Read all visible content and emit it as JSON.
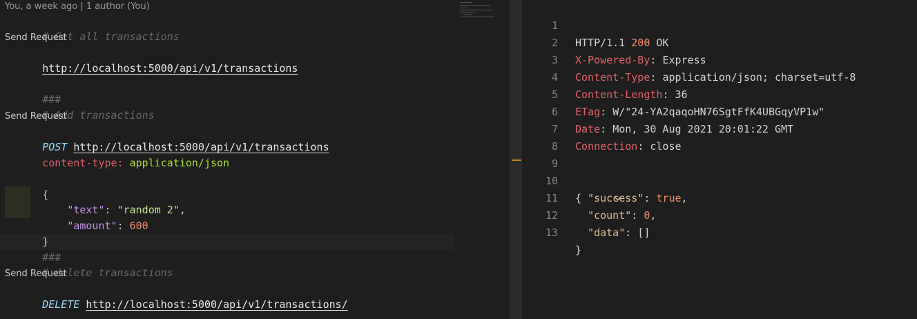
{
  "editor": {
    "blame": "You, a week ago | 1 author (You)",
    "send_request": "Send Request",
    "blocks": {
      "get": {
        "comment": "# Get all transactions",
        "url": "http://localhost:5000/api/v1/transactions"
      },
      "sep1": "###",
      "add": {
        "comment": "# Add transactions",
        "method": "POST",
        "url": "http://localhost:5000/api/v1/transactions",
        "header_key": "content-type:",
        "header_value": "application/json",
        "open_brace": "{",
        "text_key": "\"text\"",
        "text_value": "\"random 2\"",
        "amount_key": "\"amount\"",
        "amount_value": "600",
        "close_brace": "}"
      },
      "sep2": "###",
      "delete": {
        "comment": "# delete transactions",
        "method": "DELETE",
        "url": "http://localhost:5000/api/v1/transactions/"
      }
    }
  },
  "response": {
    "line_numbers": [
      "1",
      "2",
      "3",
      "4",
      "5",
      "6",
      "7",
      "8",
      "9",
      "10",
      "11",
      "12",
      "13"
    ],
    "status_protocol": "HTTP/1.1",
    "status_code": "200",
    "status_text": "OK",
    "headers": [
      {
        "key": "X-Powered-By",
        "value": "Express"
      },
      {
        "key": "Content-Type",
        "value": "application/json; charset=utf-8"
      },
      {
        "key": "Content-Length",
        "value": "36"
      },
      {
        "key": "ETag",
        "value": "W/\"24-YA2qaqoHN76SgtFfK4UBGqyVP1w\""
      },
      {
        "key": "Date",
        "value": "Mon, 30 Aug 2021 20:01:22 GMT"
      },
      {
        "key": "Connection",
        "value": "close"
      }
    ],
    "body": {
      "open": "{",
      "success_key": "\"success\"",
      "success_value": "true",
      "count_key": "\"count\"",
      "count_value": "0",
      "data_key": "\"data\"",
      "data_value": "[]",
      "close": "}"
    },
    "fold_icon": "chevron-down-icon"
  },
  "colors": {
    "background": "#1e1e1e",
    "comment": "#6a6a6a",
    "header_key": "#e0636a",
    "json_key": "#c792ea",
    "number": "#f78c6c",
    "scroll_marker": "#c08a1e"
  }
}
